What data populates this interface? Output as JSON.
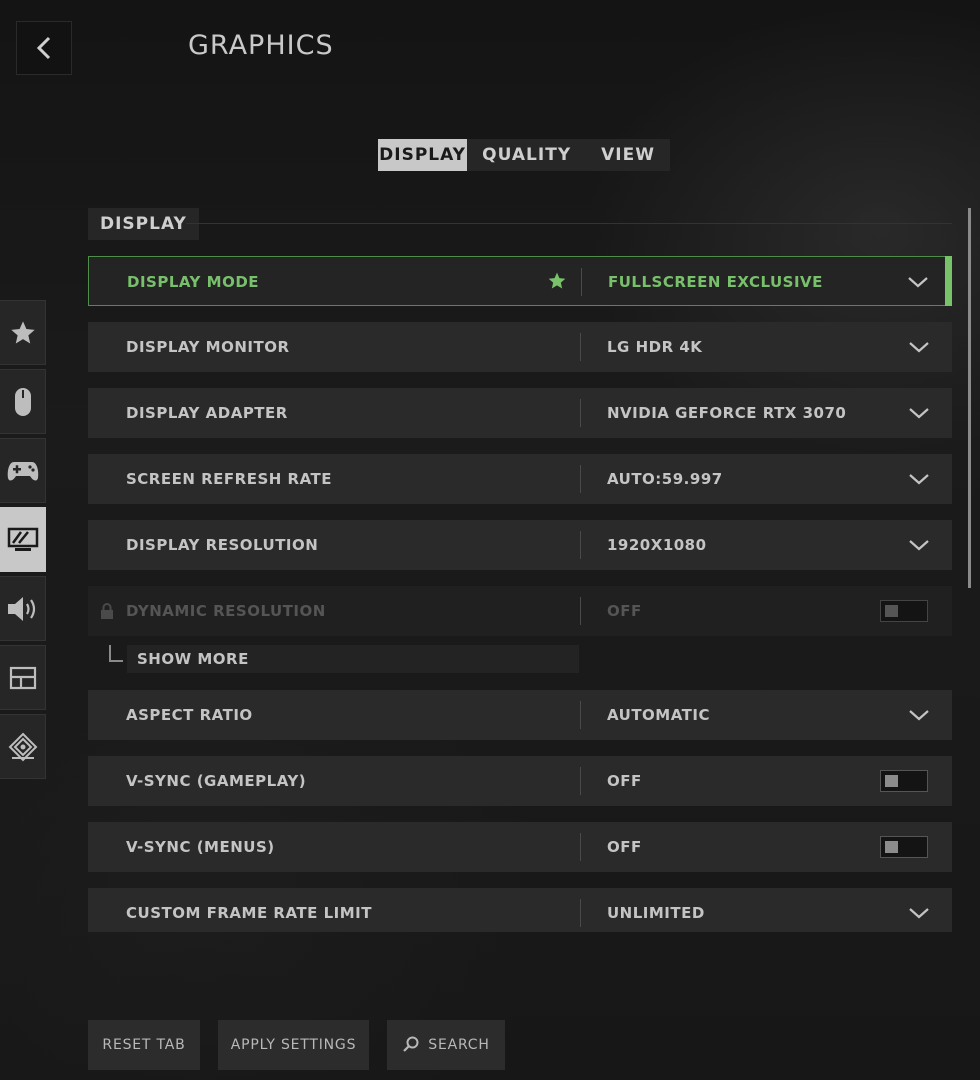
{
  "header": {
    "title": "GRAPHICS",
    "back_icon": "chevron-left-icon"
  },
  "tabs": [
    {
      "label": "DISPLAY",
      "active": true
    },
    {
      "label": "QUALITY",
      "active": false
    },
    {
      "label": "VIEW",
      "active": false
    }
  ],
  "sidebar": {
    "items": [
      {
        "icon": "star-icon",
        "active": false
      },
      {
        "icon": "mouse-icon",
        "active": false
      },
      {
        "icon": "gamepad-icon",
        "active": false
      },
      {
        "icon": "monitor-icon",
        "active": true
      },
      {
        "icon": "speaker-icon",
        "active": false
      },
      {
        "icon": "interface-icon",
        "active": false
      },
      {
        "icon": "network-icon",
        "active": false
      }
    ]
  },
  "section": {
    "title": "DISPLAY"
  },
  "settings": [
    {
      "label": "DISPLAY MODE",
      "value": "FULLSCREEN EXCLUSIVE",
      "control": "dropdown",
      "selected": true,
      "favorite": true
    },
    {
      "label": "DISPLAY MONITOR",
      "value": "LG HDR 4K",
      "control": "dropdown"
    },
    {
      "label": "DISPLAY ADAPTER",
      "value": "NVIDIA GEFORCE RTX 3070",
      "control": "dropdown"
    },
    {
      "label": "SCREEN REFRESH RATE",
      "value": "AUTO:59.997",
      "control": "dropdown"
    },
    {
      "label": "DISPLAY RESOLUTION",
      "value": "1920X1080",
      "control": "dropdown"
    },
    {
      "label": "DYNAMIC RESOLUTION",
      "value": "OFF",
      "control": "toggle",
      "disabled": true,
      "locked": true
    },
    {
      "label": "ASPECT RATIO",
      "value": "AUTOMATIC",
      "control": "dropdown"
    },
    {
      "label": "V-SYNC (GAMEPLAY)",
      "value": "OFF",
      "control": "toggle"
    },
    {
      "label": "V-SYNC (MENUS)",
      "value": "OFF",
      "control": "toggle"
    },
    {
      "label": "CUSTOM FRAME RATE LIMIT",
      "value": "UNLIMITED",
      "control": "dropdown"
    }
  ],
  "show_more": {
    "label": "SHOW MORE"
  },
  "footer": {
    "reset_label": "RESET TAB",
    "apply_label": "APPLY SETTINGS",
    "search_label": "SEARCH"
  },
  "colors": {
    "accent_green": "#78c36a",
    "active_tab_bg": "#c8c8c8"
  }
}
